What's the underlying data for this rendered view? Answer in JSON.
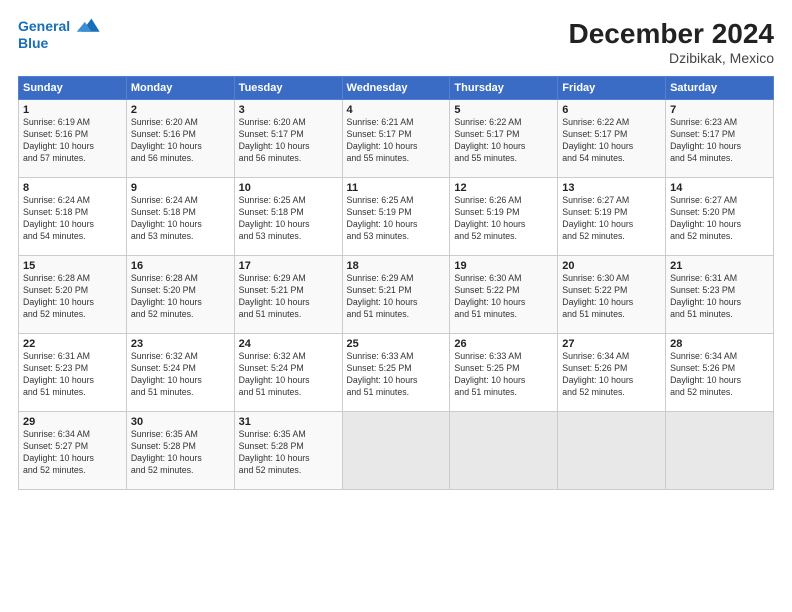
{
  "header": {
    "logo_line1": "General",
    "logo_line2": "Blue",
    "title": "December 2024",
    "subtitle": "Dzibikak, Mexico"
  },
  "weekdays": [
    "Sunday",
    "Monday",
    "Tuesday",
    "Wednesday",
    "Thursday",
    "Friday",
    "Saturday"
  ],
  "weeks": [
    [
      {
        "day": "1",
        "info": "Sunrise: 6:19 AM\nSunset: 5:16 PM\nDaylight: 10 hours\nand 57 minutes."
      },
      {
        "day": "2",
        "info": "Sunrise: 6:20 AM\nSunset: 5:16 PM\nDaylight: 10 hours\nand 56 minutes."
      },
      {
        "day": "3",
        "info": "Sunrise: 6:20 AM\nSunset: 5:17 PM\nDaylight: 10 hours\nand 56 minutes."
      },
      {
        "day": "4",
        "info": "Sunrise: 6:21 AM\nSunset: 5:17 PM\nDaylight: 10 hours\nand 55 minutes."
      },
      {
        "day": "5",
        "info": "Sunrise: 6:22 AM\nSunset: 5:17 PM\nDaylight: 10 hours\nand 55 minutes."
      },
      {
        "day": "6",
        "info": "Sunrise: 6:22 AM\nSunset: 5:17 PM\nDaylight: 10 hours\nand 54 minutes."
      },
      {
        "day": "7",
        "info": "Sunrise: 6:23 AM\nSunset: 5:17 PM\nDaylight: 10 hours\nand 54 minutes."
      }
    ],
    [
      {
        "day": "8",
        "info": "Sunrise: 6:24 AM\nSunset: 5:18 PM\nDaylight: 10 hours\nand 54 minutes."
      },
      {
        "day": "9",
        "info": "Sunrise: 6:24 AM\nSunset: 5:18 PM\nDaylight: 10 hours\nand 53 minutes."
      },
      {
        "day": "10",
        "info": "Sunrise: 6:25 AM\nSunset: 5:18 PM\nDaylight: 10 hours\nand 53 minutes."
      },
      {
        "day": "11",
        "info": "Sunrise: 6:25 AM\nSunset: 5:19 PM\nDaylight: 10 hours\nand 53 minutes."
      },
      {
        "day": "12",
        "info": "Sunrise: 6:26 AM\nSunset: 5:19 PM\nDaylight: 10 hours\nand 52 minutes."
      },
      {
        "day": "13",
        "info": "Sunrise: 6:27 AM\nSunset: 5:19 PM\nDaylight: 10 hours\nand 52 minutes."
      },
      {
        "day": "14",
        "info": "Sunrise: 6:27 AM\nSunset: 5:20 PM\nDaylight: 10 hours\nand 52 minutes."
      }
    ],
    [
      {
        "day": "15",
        "info": "Sunrise: 6:28 AM\nSunset: 5:20 PM\nDaylight: 10 hours\nand 52 minutes."
      },
      {
        "day": "16",
        "info": "Sunrise: 6:28 AM\nSunset: 5:20 PM\nDaylight: 10 hours\nand 52 minutes."
      },
      {
        "day": "17",
        "info": "Sunrise: 6:29 AM\nSunset: 5:21 PM\nDaylight: 10 hours\nand 51 minutes."
      },
      {
        "day": "18",
        "info": "Sunrise: 6:29 AM\nSunset: 5:21 PM\nDaylight: 10 hours\nand 51 minutes."
      },
      {
        "day": "19",
        "info": "Sunrise: 6:30 AM\nSunset: 5:22 PM\nDaylight: 10 hours\nand 51 minutes."
      },
      {
        "day": "20",
        "info": "Sunrise: 6:30 AM\nSunset: 5:22 PM\nDaylight: 10 hours\nand 51 minutes."
      },
      {
        "day": "21",
        "info": "Sunrise: 6:31 AM\nSunset: 5:23 PM\nDaylight: 10 hours\nand 51 minutes."
      }
    ],
    [
      {
        "day": "22",
        "info": "Sunrise: 6:31 AM\nSunset: 5:23 PM\nDaylight: 10 hours\nand 51 minutes."
      },
      {
        "day": "23",
        "info": "Sunrise: 6:32 AM\nSunset: 5:24 PM\nDaylight: 10 hours\nand 51 minutes."
      },
      {
        "day": "24",
        "info": "Sunrise: 6:32 AM\nSunset: 5:24 PM\nDaylight: 10 hours\nand 51 minutes."
      },
      {
        "day": "25",
        "info": "Sunrise: 6:33 AM\nSunset: 5:25 PM\nDaylight: 10 hours\nand 51 minutes."
      },
      {
        "day": "26",
        "info": "Sunrise: 6:33 AM\nSunset: 5:25 PM\nDaylight: 10 hours\nand 51 minutes."
      },
      {
        "day": "27",
        "info": "Sunrise: 6:34 AM\nSunset: 5:26 PM\nDaylight: 10 hours\nand 52 minutes."
      },
      {
        "day": "28",
        "info": "Sunrise: 6:34 AM\nSunset: 5:26 PM\nDaylight: 10 hours\nand 52 minutes."
      }
    ],
    [
      {
        "day": "29",
        "info": "Sunrise: 6:34 AM\nSunset: 5:27 PM\nDaylight: 10 hours\nand 52 minutes."
      },
      {
        "day": "30",
        "info": "Sunrise: 6:35 AM\nSunset: 5:28 PM\nDaylight: 10 hours\nand 52 minutes."
      },
      {
        "day": "31",
        "info": "Sunrise: 6:35 AM\nSunset: 5:28 PM\nDaylight: 10 hours\nand 52 minutes."
      },
      {
        "day": "",
        "info": ""
      },
      {
        "day": "",
        "info": ""
      },
      {
        "day": "",
        "info": ""
      },
      {
        "day": "",
        "info": ""
      }
    ]
  ]
}
